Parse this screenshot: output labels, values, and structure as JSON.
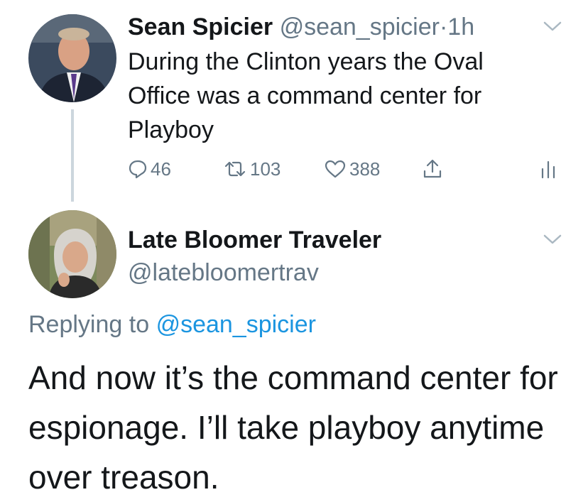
{
  "parent_tweet": {
    "author_name": "Sean Spicier",
    "handle": "@sean_spicier",
    "separator": "·",
    "time": "1h",
    "text": "During the Clinton years the Oval Office was a command center for Playboy",
    "replies": "46",
    "retweets": "103",
    "likes": "388"
  },
  "reply_tweet": {
    "author_name": "Late Bloomer Traveler",
    "handle": "@latebloomertrav",
    "replying_prefix": "Replying to",
    "replying_to": "@sean_spicier",
    "text": "And now it’s the command center for espionage. I’ll take playboy anytime over treason."
  },
  "icons": {
    "reply": "speech-bubble-icon",
    "retweet": "retweet-icon",
    "like": "heart-icon",
    "share": "share-icon",
    "analytics": "bar-chart-icon",
    "caret": "chevron-down-icon"
  },
  "colors": {
    "text": "#14171a",
    "secondary": "#657786",
    "link": "#1b95e0",
    "thread_line": "#ccd6dd"
  }
}
